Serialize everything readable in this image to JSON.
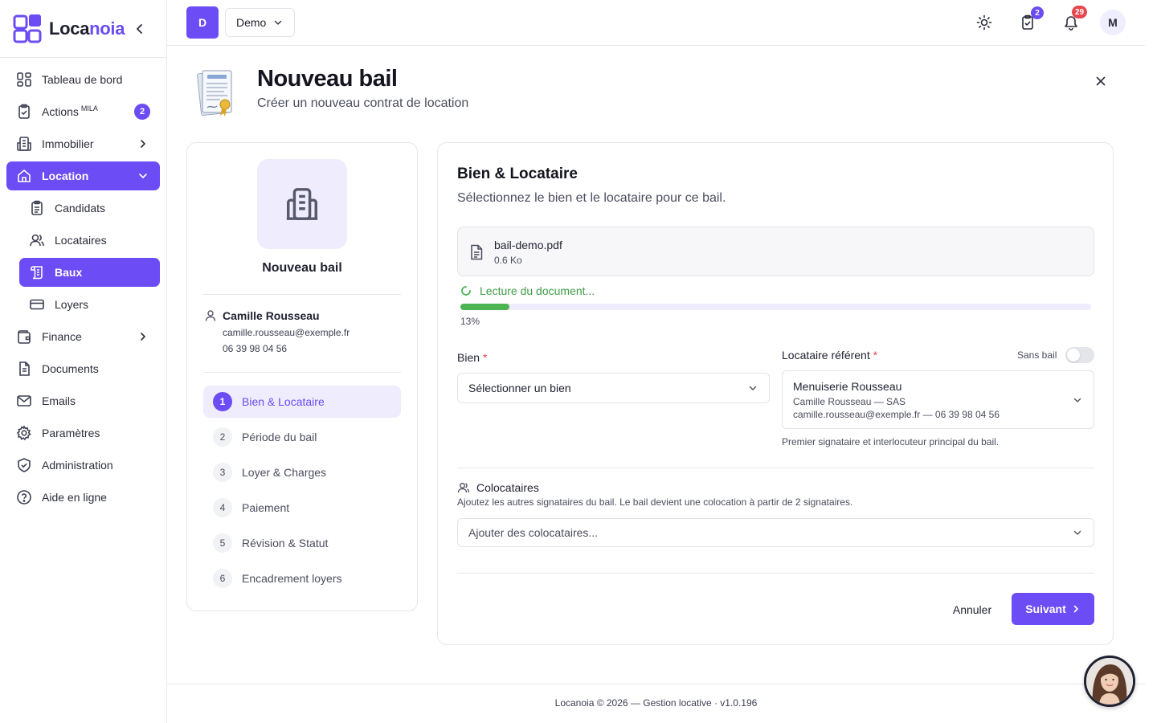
{
  "brand": {
    "name_start": "Loca",
    "name_accent": "noia",
    "accent_color": "#6c4cf5"
  },
  "sidebar": {
    "items": [
      {
        "label": "Tableau de bord",
        "icon": "dashboard-icon"
      },
      {
        "label": "Actions",
        "sup": "MILA",
        "badge": "2",
        "icon": "clipboard-check-icon"
      },
      {
        "label": "Immobilier",
        "icon": "building-icon"
      },
      {
        "label": "Location",
        "icon": "home-icon",
        "active": true
      },
      {
        "label": "Candidats",
        "icon": "clipboard-list-icon"
      },
      {
        "label": "Locataires",
        "icon": "users-icon"
      },
      {
        "label": "Baux",
        "icon": "scroll-icon",
        "active": true
      },
      {
        "label": "Loyers",
        "icon": "credit-card-icon"
      },
      {
        "label": "Finance",
        "icon": "wallet-icon"
      },
      {
        "label": "Documents",
        "icon": "document-icon"
      },
      {
        "label": "Emails",
        "icon": "mail-icon"
      },
      {
        "label": "Paramètres",
        "icon": "gear-icon"
      },
      {
        "label": "Administration",
        "icon": "shield-check-icon"
      },
      {
        "label": "Aide en ligne",
        "icon": "help-circle-icon"
      }
    ]
  },
  "topbar": {
    "org_initial": "D",
    "org_name": "Demo",
    "tasks_badge": "2",
    "notifications_badge": "29",
    "user_initial": "M"
  },
  "header": {
    "title": "Nouveau bail",
    "subtitle": "Créer un nouveau contrat de location"
  },
  "summary": {
    "title": "Nouveau bail",
    "contact": {
      "name": "Camille Rousseau",
      "email": "camille.rousseau@exemple.fr",
      "phone": "06 39 98 04 56"
    },
    "steps": [
      {
        "num": "1",
        "label": "Bien & Locataire",
        "active": true
      },
      {
        "num": "2",
        "label": "Période du bail"
      },
      {
        "num": "3",
        "label": "Loyer & Charges"
      },
      {
        "num": "4",
        "label": "Paiement"
      },
      {
        "num": "5",
        "label": "Révision & Statut"
      },
      {
        "num": "6",
        "label": "Encadrement loyers"
      }
    ]
  },
  "form": {
    "title": "Bien & Locataire",
    "subtitle": "Sélectionnez le bien et le locataire pour ce bail.",
    "file": {
      "name": "bail-demo.pdf",
      "size": "0.6 Ko"
    },
    "reading": {
      "label": "Lecture du document...",
      "percent_label": "13%",
      "progress": 0.13
    },
    "bien": {
      "label": "Bien",
      "required": "*",
      "placeholder": "Sélectionner un bien"
    },
    "locataire": {
      "label": "Locataire référent",
      "required": "*",
      "toggle_label": "Sans bail",
      "toggle_on": false,
      "name": "Menuiserie Rousseau",
      "line1": "Camille Rousseau — SAS",
      "line2": "camille.rousseau@exemple.fr — 06 39 98 04 56",
      "help": "Premier signataire et interlocuteur principal du bail."
    },
    "colocataires": {
      "title": "Colocataires",
      "help": "Ajoutez les autres signataires du bail. Le bail devient une colocation à partir de 2 signataires.",
      "placeholder": "Ajouter des colocataires..."
    },
    "actions": {
      "cancel": "Annuler",
      "next": "Suivant"
    }
  },
  "footer": {
    "text": "Locanoia © 2026 — Gestion locative · v1.0.196"
  },
  "colors": {
    "primary": "#6c4cf5",
    "success": "#4cb352",
    "danger": "#e5484d"
  }
}
